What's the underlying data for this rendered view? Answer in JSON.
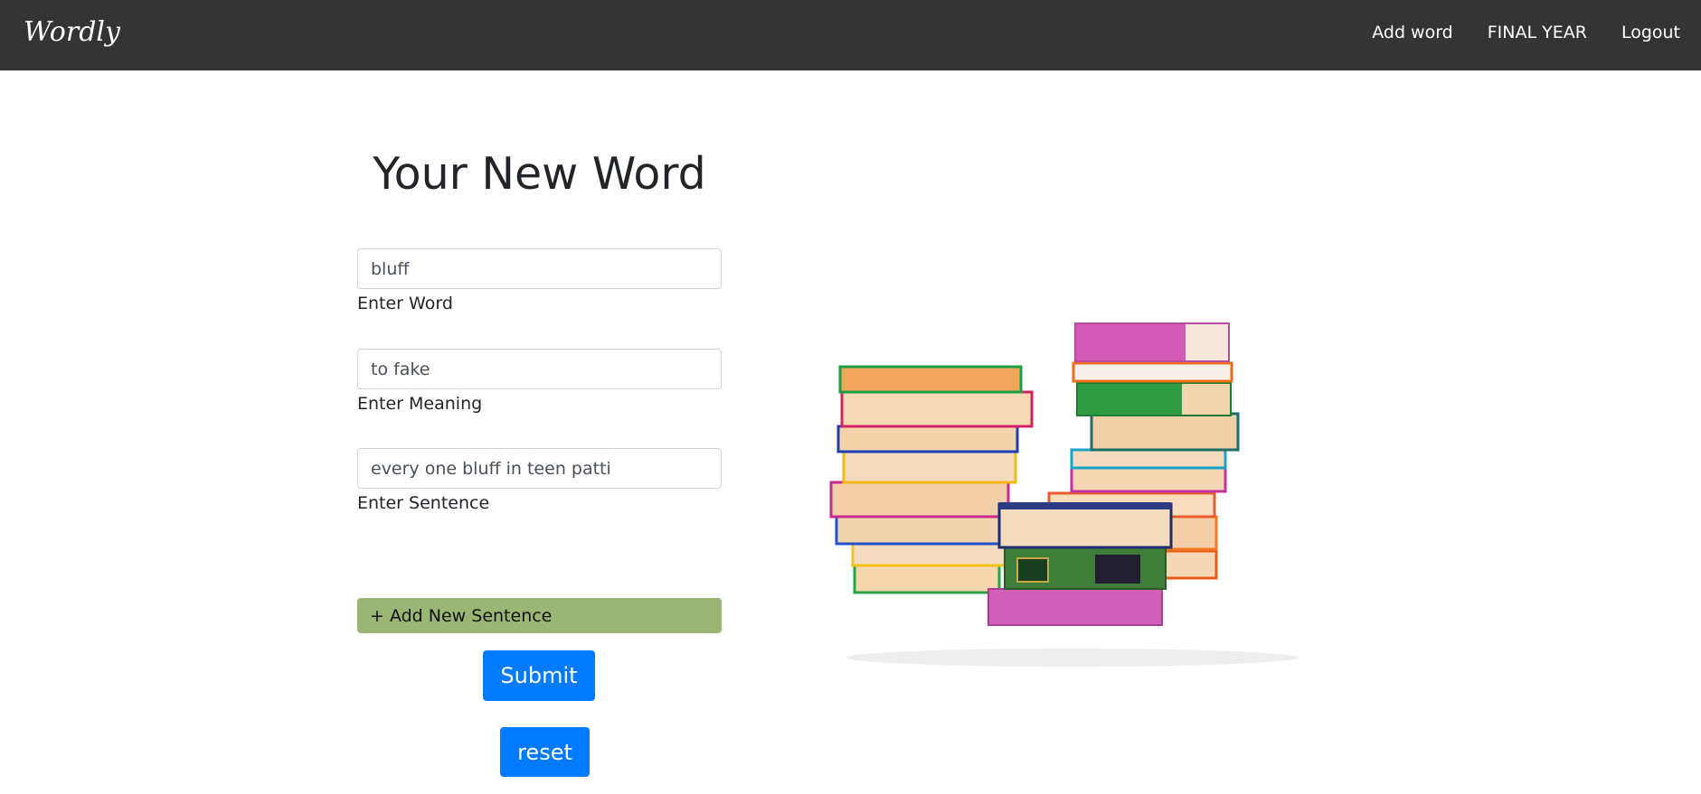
{
  "app": {
    "brand": "Wordly"
  },
  "nav": {
    "items": [
      {
        "label": "Add word"
      },
      {
        "label": "FINAL YEAR"
      },
      {
        "label": "Logout"
      }
    ]
  },
  "main": {
    "title": "Your New Word",
    "word": {
      "value": "bluff",
      "label": "Enter Word"
    },
    "meaning": {
      "value": "to fake",
      "label": "Enter Meaning"
    },
    "sentence": {
      "value": "every one bluff in teen patti",
      "label": "Enter Sentence"
    },
    "add_sentence_label": "+ Add New Sentence",
    "submit_label": "Submit",
    "reset_label": "reset"
  },
  "illustration": {
    "name": "stack-of-books-image"
  }
}
